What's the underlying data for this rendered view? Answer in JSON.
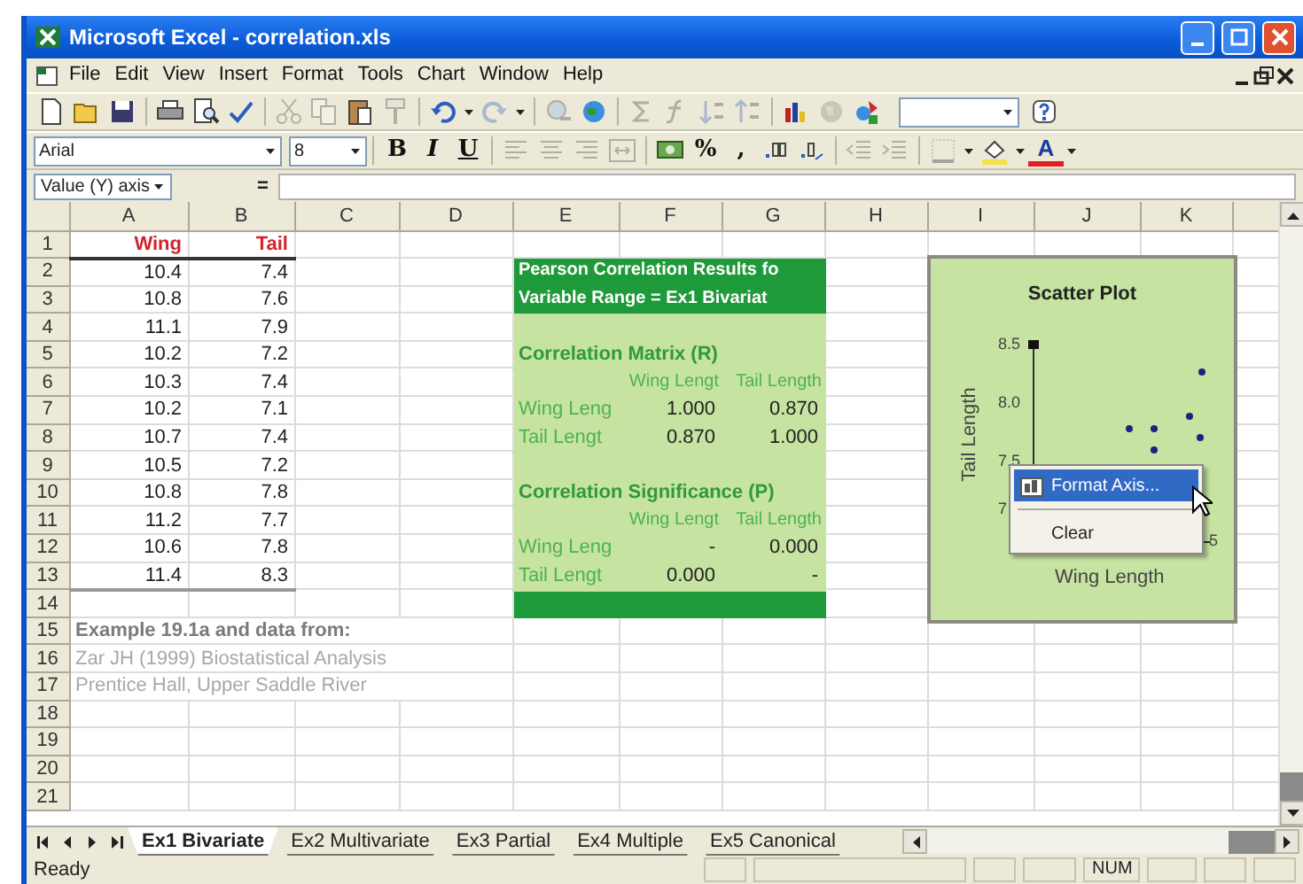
{
  "window": {
    "title": "Microsoft Excel - correlation.xls"
  },
  "menu": {
    "items": [
      "File",
      "Edit",
      "View",
      "Insert",
      "Format",
      "Tools",
      "Chart",
      "Window",
      "Help"
    ]
  },
  "standard_toolbar": {
    "buttons": [
      {
        "disabled": false
      },
      {
        "disabled": false
      },
      {
        "disabled": false
      },
      {
        "disabled": false
      },
      {
        "disabled": false
      },
      {
        "disabled": false
      },
      {
        "disabled": true
      },
      {
        "disabled": true
      },
      {
        "disabled": false
      },
      {
        "disabled": true
      },
      {
        "disabled": false
      },
      {
        "disabled": true
      },
      {
        "disabled": true
      },
      {
        "disabled": false
      },
      {
        "disabled": true
      },
      {
        "disabled": true
      },
      {
        "disabled": true
      },
      {
        "disabled": true
      },
      {
        "disabled": false
      },
      {
        "disabled": true
      },
      {
        "disabled": false
      },
      {
        "disabled": false
      }
    ]
  },
  "formatting_toolbar": {
    "font": "Arial",
    "size": "8",
    "buttons": [
      {
        "kind": "bold",
        "label": "B",
        "disabled": false
      },
      {
        "kind": "italic",
        "label": "I",
        "disabled": false
      },
      {
        "kind": "underline",
        "label": "U",
        "disabled": false
      },
      {
        "kind": "icon",
        "disabled": true
      },
      {
        "kind": "icon",
        "disabled": true
      },
      {
        "kind": "icon",
        "disabled": true
      },
      {
        "kind": "icon",
        "disabled": true
      },
      {
        "kind": "icon",
        "disabled": false
      },
      {
        "kind": "text",
        "label": "%",
        "disabled": false
      },
      {
        "kind": "text",
        "label": ",",
        "disabled": false
      },
      {
        "kind": "icon",
        "disabled": false
      },
      {
        "kind": "icon",
        "disabled": false
      },
      {
        "kind": "icon",
        "disabled": true
      },
      {
        "kind": "icon",
        "disabled": true
      },
      {
        "kind": "icon",
        "disabled": true
      },
      {
        "kind": "icon",
        "disabled": false
      },
      {
        "kind": "font-color",
        "label": "A",
        "disabled": false
      }
    ]
  },
  "formula_bar": {
    "name_box": "Value (Y) axis",
    "equals": "="
  },
  "sheet": {
    "columns": [
      "A",
      "B",
      "C",
      "D",
      "E",
      "F",
      "G",
      "H",
      "I",
      "J",
      "K"
    ],
    "rows": [
      "1",
      "2",
      "3",
      "4",
      "5",
      "6",
      "7",
      "8",
      "9",
      "10",
      "11",
      "12",
      "13",
      "14",
      "15",
      "16",
      "17",
      "18",
      "19",
      "20",
      "21"
    ]
  },
  "data_table": {
    "headers": [
      "Wing",
      "Tail"
    ],
    "rows": [
      [
        "10.4",
        "7.4"
      ],
      [
        "10.8",
        "7.6"
      ],
      [
        "11.1",
        "7.9"
      ],
      [
        "10.2",
        "7.2"
      ],
      [
        "10.3",
        "7.4"
      ],
      [
        "10.2",
        "7.1"
      ],
      [
        "10.7",
        "7.4"
      ],
      [
        "10.5",
        "7.2"
      ],
      [
        "10.8",
        "7.8"
      ],
      [
        "11.2",
        "7.7"
      ],
      [
        "10.6",
        "7.8"
      ],
      [
        "11.4",
        "8.3"
      ]
    ]
  },
  "notes": [
    {
      "kind": "heading",
      "text": "Example 19.1a and data from:"
    },
    {
      "kind": "plain",
      "text": "Zar JH (1999) Biostatistical Analysis"
    },
    {
      "kind": "plain",
      "text": "Prentice Hall, Upper Saddle River"
    }
  ],
  "pearson": {
    "title_lines": [
      "Pearson Correlation Results fo",
      "Variable Range = Ex1 Bivariat"
    ],
    "sections": [
      {
        "title": "Correlation Matrix (R)",
        "headers": [
          "Wing Lengt",
          "Tail Length"
        ],
        "rows": [
          {
            "label": "Wing Leng",
            "values": [
              "1.000",
              "0.870"
            ]
          },
          {
            "label": "Tail Lengt",
            "values": [
              "0.870",
              "1.000"
            ]
          }
        ]
      },
      {
        "title": "Correlation Significance (P)",
        "headers": [
          "Wing Lengt",
          "Tail Length"
        ],
        "rows": [
          {
            "label": "Wing Leng",
            "values": [
              "-",
              "0.000"
            ]
          },
          {
            "label": "Tail Lengt",
            "values": [
              "0.000",
              "-"
            ]
          }
        ]
      }
    ]
  },
  "chart": {
    "title": "Scatter Plot",
    "ylabel": "Tail Length",
    "xlabel": "Wing Length",
    "y_tick_labels": [
      "8.5",
      "8.0",
      "7.5",
      "7"
    ],
    "x_tick_label": "5"
  },
  "context_menu": {
    "items": [
      {
        "label": "Format Axis...",
        "selected": true
      },
      {
        "label": "Clear",
        "selected": false
      }
    ]
  },
  "sheet_tabs": [
    {
      "label": "Ex1 Bivariate",
      "selected": true
    },
    {
      "label": "Ex2 Multivariate",
      "selected": false
    },
    {
      "label": "Ex3 Partial",
      "selected": false
    },
    {
      "label": "Ex4 Multiple",
      "selected": false
    },
    {
      "label": "Ex5 Canonical",
      "selected": false
    }
  ],
  "status_bar": {
    "message": "Ready",
    "indicator": "NUM"
  }
}
